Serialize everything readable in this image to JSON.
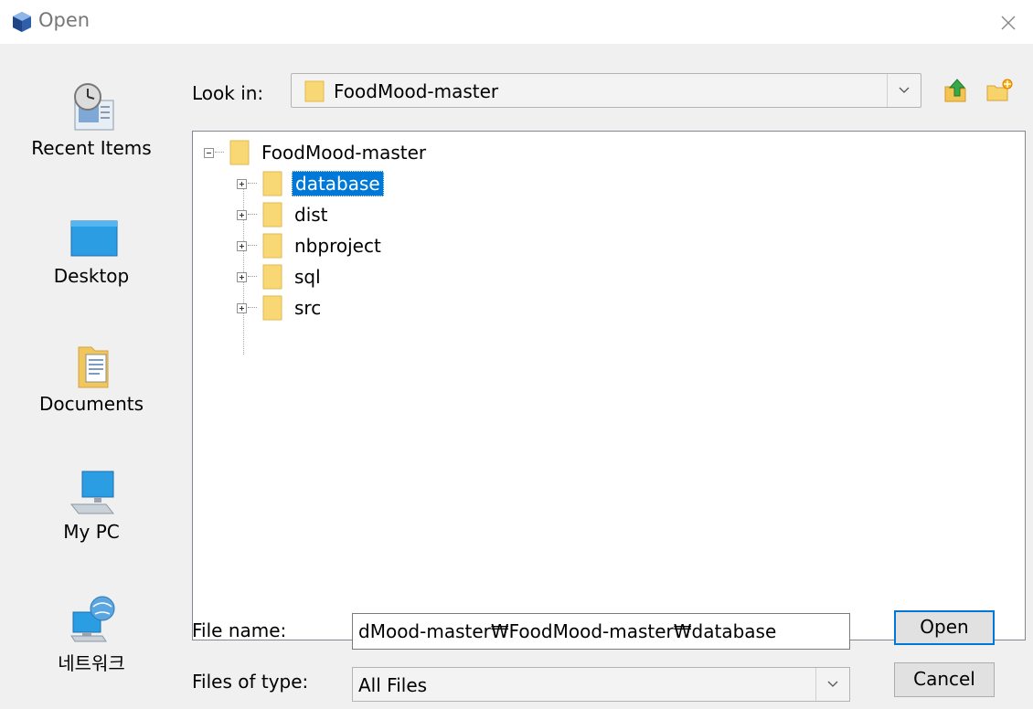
{
  "window": {
    "title": "Open"
  },
  "places": [
    {
      "label": "Recent Items",
      "icon": "recent-items-icon"
    },
    {
      "label": "Desktop",
      "icon": "desktop-icon"
    },
    {
      "label": "Documents",
      "icon": "documents-icon"
    },
    {
      "label": "My PC",
      "icon": "my-pc-icon"
    },
    {
      "label": "네트워크",
      "icon": "network-icon"
    }
  ],
  "lookin": {
    "label": "Look in:",
    "value": "FoodMood-master"
  },
  "tree": {
    "root": "FoodMood-master",
    "children": [
      "database",
      "dist",
      "nbproject",
      "sql",
      "src"
    ],
    "selected": "database"
  },
  "filename": {
    "label": "File name:",
    "value": "dMood-master₩FoodMood-master₩database"
  },
  "filetype": {
    "label": "Files of type:",
    "value": "All Files"
  },
  "buttons": {
    "open": "Open",
    "cancel": "Cancel"
  },
  "colors": {
    "selection": "#0078d7",
    "folder": "#f8d775",
    "folder_edge": "#e3b94f"
  }
}
